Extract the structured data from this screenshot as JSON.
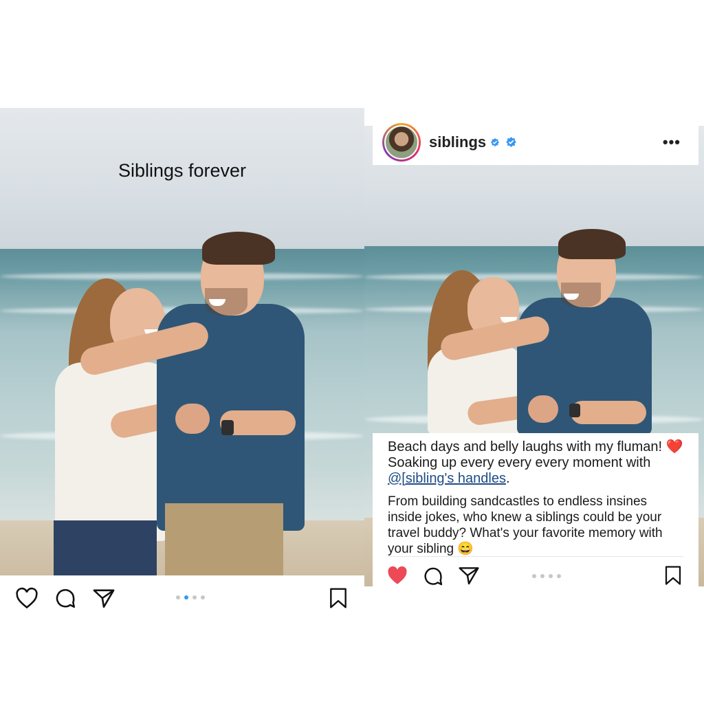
{
  "left_post": {
    "overlay_text": "Siblings forever",
    "carousel": {
      "count": 4,
      "active_index": 1
    },
    "actions": {
      "like_icon": "heart-outline-icon",
      "comment_icon": "comment-icon",
      "share_icon": "send-icon",
      "save_icon": "bookmark-icon"
    }
  },
  "right_post": {
    "header": {
      "username": "siblings",
      "verified_icon": "verified-badge-icon",
      "more_icon": "more-options-icon",
      "more_label": "•••"
    },
    "caption": {
      "line_intro": "Beach days and belly laughs with my fluman! ",
      "heart_emoji": "❤️",
      "line_mid": " Soaking up every every every moment with ",
      "mention": "@[sibling's handles",
      "line_end": ".",
      "paragraph2": "From building sandcastles to endless insines inside jokes, who knew a siblings could be your travel buddy? What's your favorite memory with your sibling ",
      "emoji_end": "😄"
    },
    "carousel": {
      "count": 4,
      "active_index": -1
    },
    "actions": {
      "like_icon": "heart-filled-icon",
      "comment_icon": "comment-icon",
      "share_icon": "send-icon",
      "save_icon": "bookmark-icon"
    }
  },
  "colors": {
    "like_red": "#ed4956",
    "verified_blue": "#3897f0",
    "active_dot": "#3897f0",
    "mention": "#1c4b86"
  }
}
